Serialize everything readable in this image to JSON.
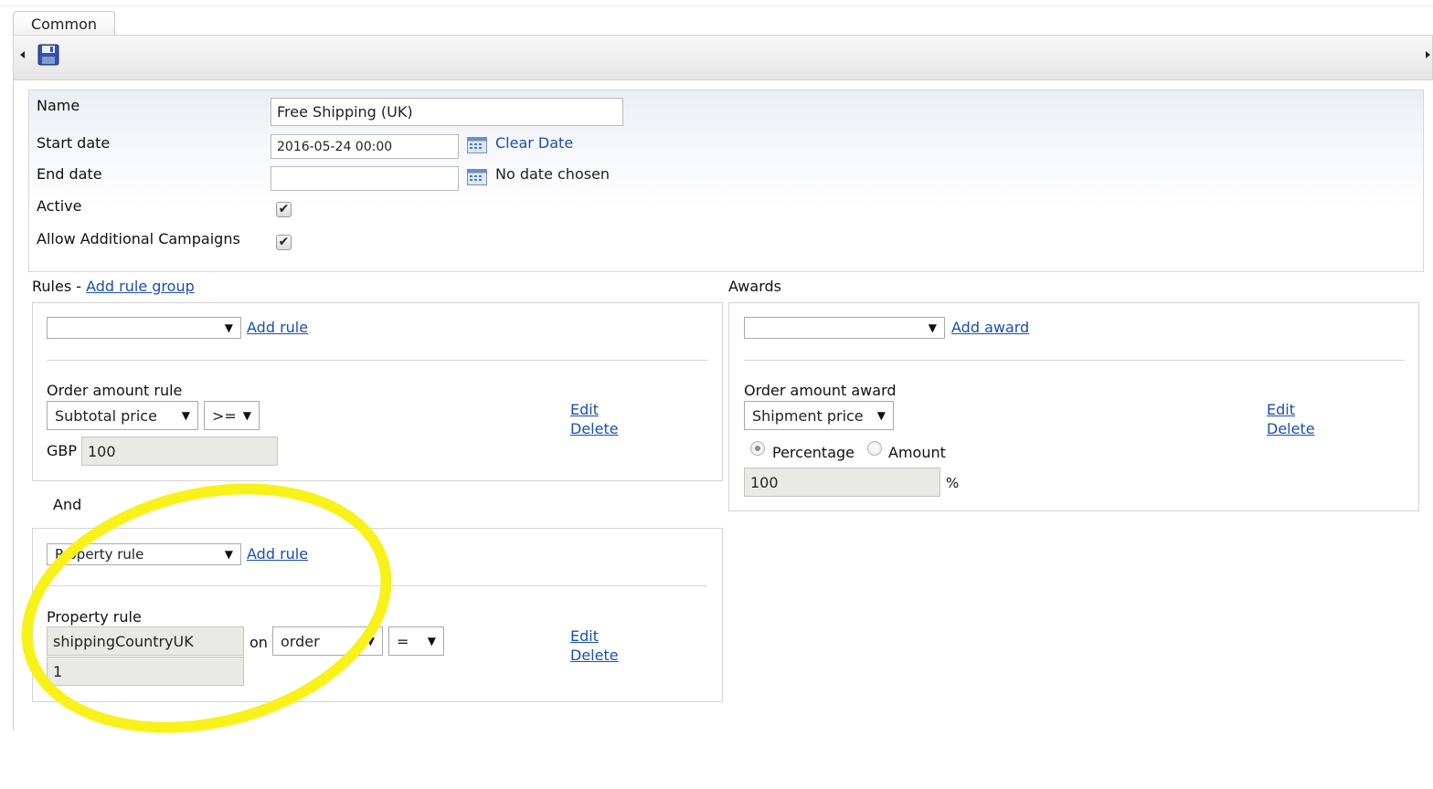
{
  "tabs": {
    "common": "Common"
  },
  "toolbar": {
    "save_icon": "floppy-disk-icon"
  },
  "form": {
    "name_label": "Name",
    "name_value": "Free Shipping (UK)",
    "start_label": "Start date",
    "start_value": "2016-05-24 00:00",
    "clear_date": "Clear Date",
    "end_label": "End date",
    "end_value": "",
    "no_date": "No date chosen",
    "active_label": "Active",
    "active_checked": true,
    "allow_label": "Allow Additional Campaigns",
    "allow_checked": true,
    "check_glyph": "✔"
  },
  "rules": {
    "title": "Rules - ",
    "add_group": "Add rule group",
    "group1": {
      "select_value": "",
      "add_rule": "Add rule",
      "rule_title": "Order amount rule",
      "field_select": "Subtotal price",
      "op_select": ">=",
      "currency": "GBP",
      "amount": "100",
      "edit": "Edit",
      "delete": "Delete"
    },
    "and_label": "And",
    "group2": {
      "select_value": "Property rule",
      "add_rule": "Add rule",
      "rule_title": "Property rule",
      "property": "shippingCountryUK",
      "on": "on",
      "target_select": "order",
      "op_select": "=",
      "value": "1",
      "edit": "Edit",
      "delete": "Delete"
    }
  },
  "awards": {
    "title": "Awards",
    "select_value": "",
    "add_award": "Add award",
    "award_title": "Order amount award",
    "field_select": "Shipment price",
    "percentage": "Percentage",
    "amount_label": "Amount",
    "selected": "Percentage",
    "value": "100",
    "percent_sign": "%",
    "edit": "Edit",
    "delete": "Delete"
  },
  "colors": {
    "link": "#1a4fb0",
    "highlight": "#f8f21a"
  },
  "caret": "▼"
}
